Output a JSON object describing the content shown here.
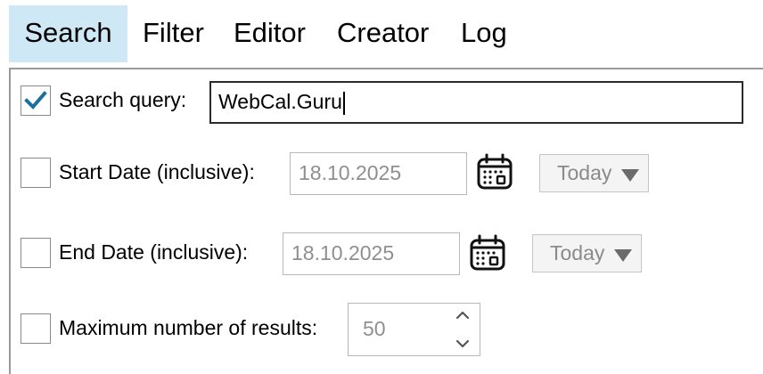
{
  "tabs": [
    {
      "label": "Search",
      "active": true
    },
    {
      "label": "Filter",
      "active": false
    },
    {
      "label": "Editor",
      "active": false
    },
    {
      "label": "Creator",
      "active": false
    },
    {
      "label": "Log",
      "active": false
    }
  ],
  "search_query": {
    "checked": true,
    "label": "Search query:",
    "value": "WebCal.Guru"
  },
  "start_date": {
    "checked": false,
    "label": "Start Date (inclusive):",
    "value": "18.10.2025",
    "calendar_icon": "calendar-icon",
    "preset": "Today"
  },
  "end_date": {
    "checked": false,
    "label": "End Date (inclusive):",
    "value": "18.10.2025",
    "calendar_icon": "calendar-icon",
    "preset": "Today"
  },
  "max_results": {
    "checked": false,
    "label": "Maximum number of results:",
    "value": "50"
  },
  "colors": {
    "active_tab_bg": "#cfe8f5",
    "check_mark": "#1a6fa0"
  }
}
